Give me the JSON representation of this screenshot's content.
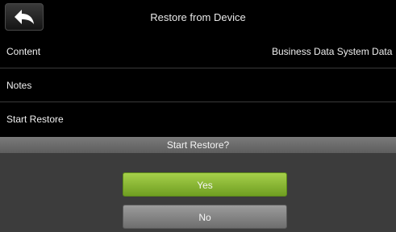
{
  "header": {
    "title": "Restore from Device",
    "back_icon": "back-arrow-icon"
  },
  "rows": [
    {
      "label": "Content",
      "value": "Business Data System Data"
    },
    {
      "label": "Notes",
      "value": ""
    },
    {
      "label": "Start Restore",
      "value": ""
    }
  ],
  "dialog": {
    "title": "Start Restore?",
    "yes_label": "Yes",
    "no_label": "No"
  },
  "colors": {
    "background": "#000000",
    "yes_button": "#8cbf35",
    "no_button": "#858585",
    "dialog_header": "#6c6c6c",
    "dialog_body": "#3c3c3c"
  }
}
